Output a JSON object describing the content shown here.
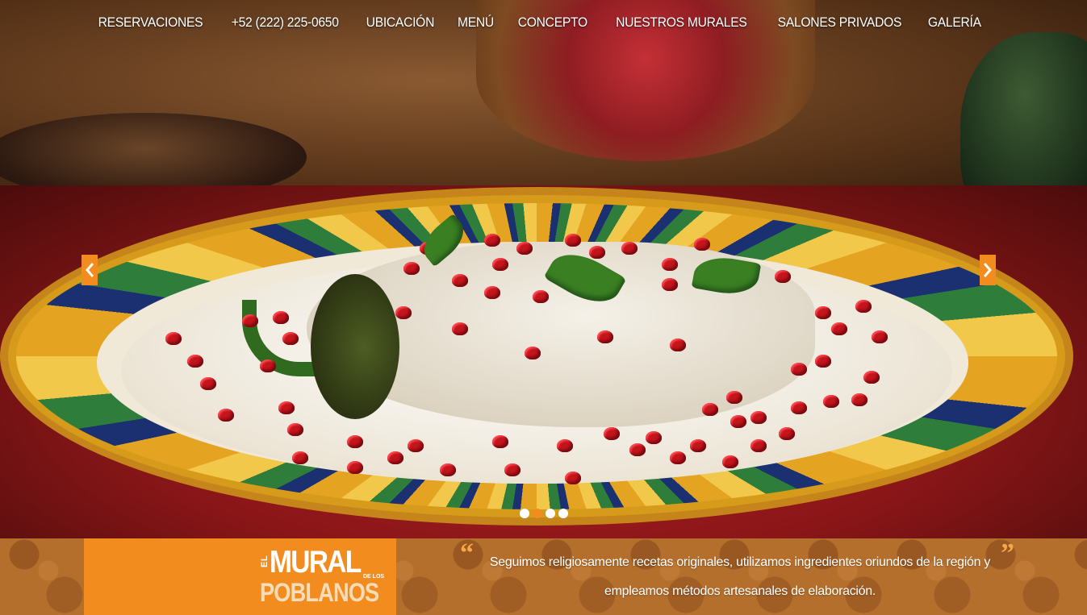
{
  "nav": {
    "items": [
      {
        "label": "RESERVACIONES"
      },
      {
        "label": "+52 (222) 225-0650"
      },
      {
        "label": "UBICACIÓN"
      },
      {
        "label": "MENÚ"
      },
      {
        "label": "CONCEPTO"
      },
      {
        "label": "NUESTROS MURALES"
      },
      {
        "label": "SALONES PRIVADOS"
      },
      {
        "label": "GALERÍA"
      }
    ]
  },
  "slider": {
    "prev_icon": "chevron-left-icon",
    "next_icon": "chevron-right-icon",
    "dot_count": 4,
    "active_dot": 1,
    "accent_color": "#f28c1f"
  },
  "logo": {
    "el": "EL",
    "mural": "MURAL",
    "de_los": "DE LOS",
    "poblanos": "POBLANOS"
  },
  "quote": {
    "text": "Seguimos religiosamente recetas originales, utilizamos ingredientes oriundos de la región y empleamos métodos artesanales de elaboración.",
    "open_mark": "“",
    "close_mark": "”"
  },
  "colors": {
    "accent": "#f28c1f",
    "band": "#b56f2c"
  }
}
